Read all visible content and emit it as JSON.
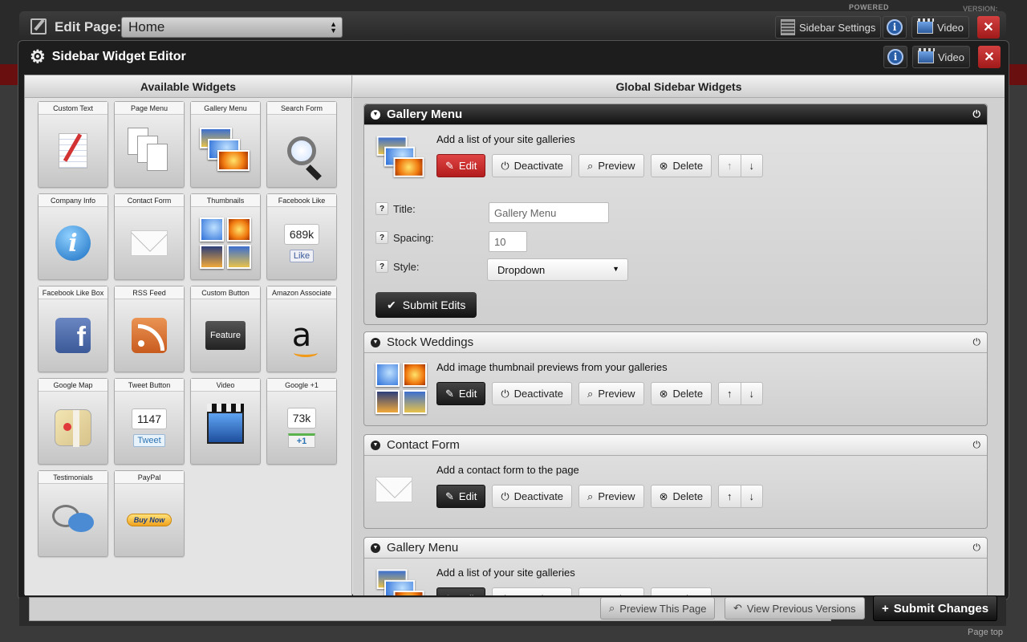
{
  "brand": {
    "powered": "POWERED",
    "version": "VERSION:",
    "page_top": "Page top"
  },
  "topbar": {
    "edit_label": "Edit Page:",
    "page_select": "Home",
    "sidebar_settings": "Sidebar Settings",
    "video": "Video",
    "info": "i",
    "close": "✕"
  },
  "modal": {
    "title": "Sidebar Widget Editor",
    "info": "i",
    "video": "Video",
    "close": "✕"
  },
  "available": {
    "heading": "Available Widgets",
    "tiles": [
      {
        "label": "Custom Text",
        "icon": "notepad-icon"
      },
      {
        "label": "Page Menu",
        "icon": "pages-icon"
      },
      {
        "label": "Gallery Menu",
        "icon": "photos-icon"
      },
      {
        "label": "Search Form",
        "icon": "magnifier-icon"
      },
      {
        "label": "Company Info",
        "icon": "info-icon"
      },
      {
        "label": "Contact Form",
        "icon": "envelope-icon"
      },
      {
        "label": "Thumbnails",
        "icon": "thumbnails-icon"
      },
      {
        "label": "Facebook Like",
        "icon": "facebook-like-icon",
        "count": "689k",
        "button": "Like"
      },
      {
        "label": "Facebook Like Box",
        "icon": "facebook-icon",
        "glyph": "f"
      },
      {
        "label": "RSS Feed",
        "icon": "rss-icon"
      },
      {
        "label": "Custom Button",
        "icon": "feature-button-icon",
        "text": "Feature"
      },
      {
        "label": "Amazon Associate",
        "icon": "amazon-icon",
        "glyph": "a"
      },
      {
        "label": "Google Map",
        "icon": "map-icon"
      },
      {
        "label": "Tweet Button",
        "icon": "tweet-icon",
        "count": "1147",
        "button": "Tweet"
      },
      {
        "label": "Video",
        "icon": "clapperboard-icon"
      },
      {
        "label": "Google +1",
        "icon": "google-plus-icon",
        "count": "73k",
        "button": "+1"
      },
      {
        "label": "Testimonials",
        "icon": "speech-bubbles-icon"
      },
      {
        "label": "PayPal",
        "icon": "paypal-icon",
        "text": "Buy Now"
      }
    ]
  },
  "global": {
    "heading": "Global Sidebar Widgets",
    "buttons": {
      "edit": "Edit",
      "deactivate": "Deactivate",
      "preview": "Preview",
      "delete": "Delete",
      "up": "↑",
      "down": "↓"
    },
    "widgets": [
      {
        "title": "Gallery Menu",
        "desc": "Add a list of your site galleries",
        "expanded": true,
        "fields": {
          "title_label": "Title:",
          "title_value": "Gallery Menu",
          "spacing_label": "Spacing:",
          "spacing_value": "10",
          "style_label": "Style:",
          "style_value": "Dropdown",
          "help": "?"
        },
        "submit": "Submit Edits"
      },
      {
        "title": "Stock Weddings",
        "desc": "Add image thumbnail previews from your galleries"
      },
      {
        "title": "Contact Form",
        "desc": "Add a contact form to the page"
      },
      {
        "title": "Gallery Menu",
        "desc": "Add a list of your site galleries"
      }
    ]
  },
  "footer": {
    "preview_page": "Preview This Page",
    "previous_versions": "View Previous Versions",
    "submit_changes": "Submit Changes"
  },
  "colors": {
    "accent_red": "#c62828",
    "dark": "#1d1d1d",
    "info_blue": "#2a5fa8"
  }
}
